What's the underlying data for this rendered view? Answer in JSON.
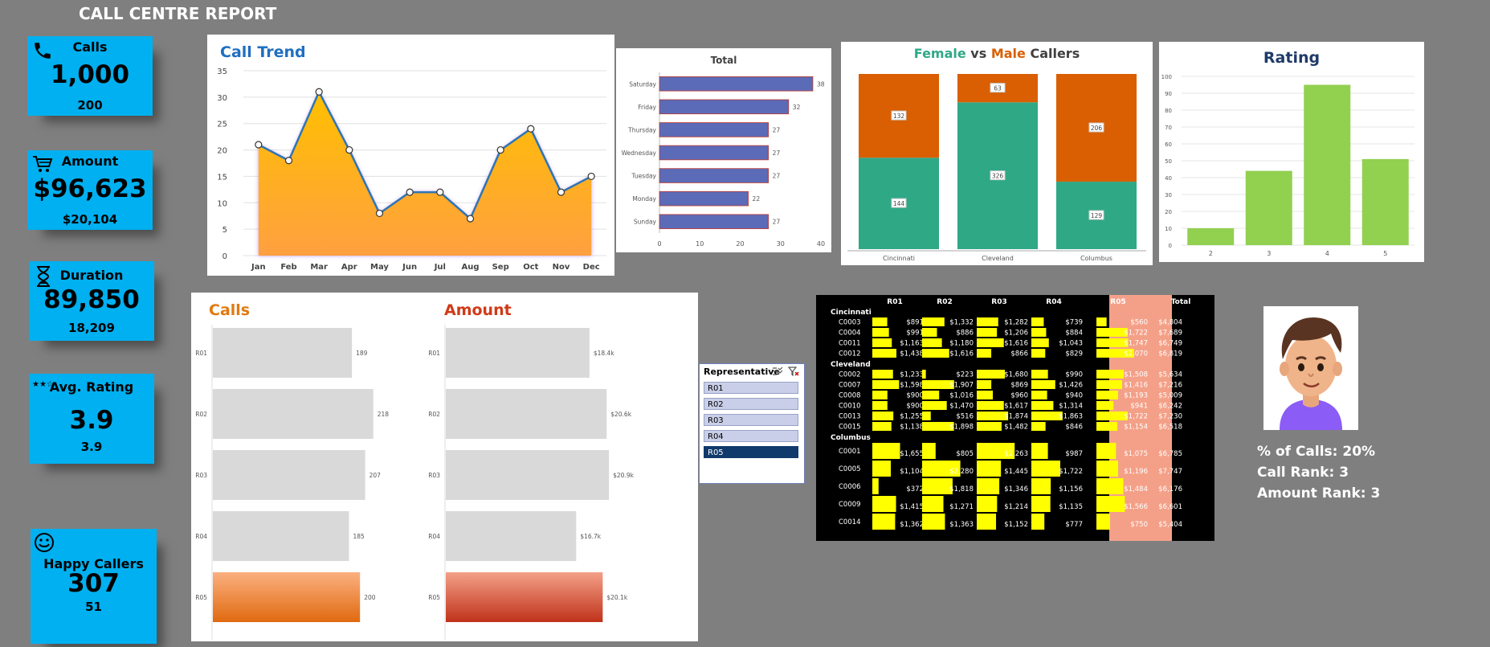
{
  "report_title": "CALL CENTRE REPORT",
  "kpis": {
    "calls": {
      "label": "Calls",
      "value": "1,000",
      "sub": "200",
      "icon": "phone-icon"
    },
    "amount": {
      "label": "Amount",
      "value": "$96,623",
      "sub": "$20,104",
      "icon": "cart-icon"
    },
    "duration": {
      "label": "Duration",
      "value": "89,850",
      "sub": "18,209",
      "icon": "hourglass-icon"
    },
    "rating": {
      "label": "Avg. Rating",
      "value": "3.9",
      "sub": "3.9",
      "icon": "stars-icon"
    },
    "happy": {
      "label": "Happy Callers",
      "value": "307",
      "sub": "51",
      "icon": "smiley-icon"
    }
  },
  "colors": {
    "kpi_bg": "#00b0f0",
    "accent_orange": "#e07a10",
    "teal": "#2fa886",
    "orange": "#d95f02",
    "green": "#92d050",
    "navy_bar": "#5b6bb8",
    "highlight": "#f4a088"
  },
  "charts": {
    "call_trend": {
      "type": "area",
      "title": "Call Trend",
      "categories": [
        "Jan",
        "Feb",
        "Mar",
        "Apr",
        "May",
        "Jun",
        "Jul",
        "Aug",
        "Sep",
        "Oct",
        "Nov",
        "Dec"
      ],
      "values": [
        21,
        18,
        31,
        20,
        8,
        12,
        12,
        7,
        20,
        24,
        12,
        15
      ],
      "yticks": [
        "0",
        "5",
        "10",
        "15",
        "20",
        "25",
        "30",
        "35"
      ],
      "ylim": [
        0,
        35
      ]
    },
    "weekday": {
      "type": "bar",
      "title": "Total",
      "categories": [
        "Saturday",
        "Friday",
        "Thursday",
        "Wednesday",
        "Tuesday",
        "Monday",
        "Sunday"
      ],
      "values": [
        38,
        32,
        27,
        27,
        27,
        22,
        27
      ],
      "xticks": [
        "0",
        "10",
        "20",
        "30",
        "40"
      ],
      "xlim": [
        0,
        40
      ]
    },
    "gender": {
      "type": "bar",
      "title_part1": "Female",
      "title_part2": " vs ",
      "title_part3": "Male",
      "title_part4": " Callers",
      "categories": [
        "Cincinnati",
        "Cleveland",
        "Columbus"
      ],
      "series": [
        {
          "values": [
            144,
            326,
            129
          ]
        },
        {
          "values": [
            132,
            63,
            206
          ]
        }
      ]
    },
    "rating": {
      "type": "bar",
      "title": "Rating",
      "categories": [
        "2",
        "3",
        "4",
        "5"
      ],
      "values": [
        10,
        44,
        95,
        51
      ],
      "yticks": [
        "0",
        "10",
        "20",
        "30",
        "40",
        "50",
        "60",
        "70",
        "80",
        "90",
        "100"
      ],
      "ylim": [
        0,
        100
      ]
    },
    "rep_calls": {
      "type": "bar",
      "title": "Calls",
      "categories": [
        "R01",
        "R02",
        "R03",
        "R04",
        "R05"
      ],
      "values": [
        189,
        218,
        207,
        185,
        200
      ],
      "labels": [
        "189",
        "218",
        "207",
        "185",
        "200"
      ],
      "xlim": [
        0,
        250
      ]
    },
    "rep_amount": {
      "type": "bar",
      "title": "Amount",
      "categories": [
        "R01",
        "R02",
        "R03",
        "R04",
        "R05"
      ],
      "values": [
        18.4,
        20.6,
        20.9,
        16.7,
        20.1
      ],
      "labels": [
        "$18.4k",
        "$20.6k",
        "$20.9k",
        "$16.7k",
        "$20.1k"
      ],
      "xlim": [
        0,
        25
      ]
    }
  },
  "slicer": {
    "header": "Representative",
    "items": [
      "R01",
      "R02",
      "R03",
      "R04",
      "R05"
    ],
    "selected": "R05"
  },
  "pivot": {
    "columns": [
      "R01",
      "R02",
      "R03",
      "R04",
      "R05",
      "Total"
    ],
    "groups": [
      {
        "name": "Cincinnati",
        "rows": [
          {
            "id": "C0003",
            "cells": [
              "$891",
              "$1,332",
              "$1,282",
              "$739",
              "$560",
              "$4,804"
            ],
            "vals": [
              891,
              1332,
              1282,
              739,
              560
            ]
          },
          {
            "id": "C0004",
            "cells": [
              "$991",
              "$886",
              "$1,206",
              "$884",
              "$1,722",
              "$7,689"
            ],
            "vals": [
              991,
              886,
              1206,
              884,
              1722
            ]
          },
          {
            "id": "C0011",
            "cells": [
              "$1,163",
              "$1,180",
              "$1,616",
              "$1,043",
              "$1,747",
              "$6,749"
            ],
            "vals": [
              1163,
              1180,
              1616,
              1043,
              1747
            ]
          },
          {
            "id": "C0012",
            "cells": [
              "$1,438",
              "$1,616",
              "$866",
              "$829",
              "$2,070",
              "$6,819"
            ],
            "vals": [
              1438,
              1616,
              866,
              829,
              2070
            ]
          }
        ]
      },
      {
        "name": "Cleveland",
        "rows": [
          {
            "id": "C0002",
            "cells": [
              "$1,233",
              "$223",
              "$1,680",
              "$990",
              "$1,508",
              "$5,634"
            ],
            "vals": [
              1233,
              223,
              1680,
              990,
              1508
            ]
          },
          {
            "id": "C0007",
            "cells": [
              "$1,598",
              "$1,907",
              "$869",
              "$1,426",
              "$1,416",
              "$7,216"
            ],
            "vals": [
              1598,
              1907,
              869,
              1426,
              1416
            ]
          },
          {
            "id": "C0008",
            "cells": [
              "$900",
              "$1,016",
              "$960",
              "$940",
              "$1,193",
              "$5,009"
            ],
            "vals": [
              900,
              1016,
              960,
              940,
              1193
            ]
          },
          {
            "id": "C0010",
            "cells": [
              "$900",
              "$1,470",
              "$1,617",
              "$1,314",
              "$941",
              "$6,242"
            ],
            "vals": [
              900,
              1470,
              1617,
              1314,
              941
            ]
          },
          {
            "id": "C0013",
            "cells": [
              "$1,255",
              "$516",
              "$1,874",
              "$1,863",
              "$1,722",
              "$7,230"
            ],
            "vals": [
              1255,
              516,
              1874,
              1863,
              1722
            ]
          },
          {
            "id": "C0015",
            "cells": [
              "$1,138",
              "$1,898",
              "$1,482",
              "$846",
              "$1,154",
              "$6,518"
            ],
            "vals": [
              1138,
              1898,
              1482,
              846,
              1154
            ]
          }
        ]
      },
      {
        "name": "Columbus",
        "rows": [
          {
            "id": "C0001",
            "cells": [
              "$1,655",
              "$805",
              "$2,263",
              "$987",
              "$1,075",
              "$6,785"
            ],
            "vals": [
              1655,
              805,
              2263,
              987,
              1075
            ]
          },
          {
            "id": "C0005",
            "cells": [
              "$1,104",
              "$2,280",
              "$1,445",
              "$1,722",
              "$1,196",
              "$7,747"
            ],
            "vals": [
              1104,
              2280,
              1445,
              1722,
              1196
            ]
          },
          {
            "id": "C0006",
            "cells": [
              "$372",
              "$1,818",
              "$1,346",
              "$1,156",
              "$1,484",
              "$6,176"
            ],
            "vals": [
              372,
              1818,
              1346,
              1156,
              1484
            ]
          },
          {
            "id": "C0009",
            "cells": [
              "$1,415",
              "$1,271",
              "$1,214",
              "$1,135",
              "$1,566",
              "$6,601"
            ],
            "vals": [
              1415,
              1271,
              1214,
              1135,
              1566
            ]
          },
          {
            "id": "C0014",
            "cells": [
              "$1,362",
              "$1,363",
              "$1,152",
              "$777",
              "$750",
              "$5,404"
            ],
            "vals": [
              1362,
              1363,
              1152,
              777,
              750
            ]
          }
        ]
      }
    ]
  },
  "rep_stats": {
    "pct_calls": "% of Calls: 20%",
    "call_rank": "Call Rank: 3",
    "amount_rank": "Amount Rank: 3"
  }
}
